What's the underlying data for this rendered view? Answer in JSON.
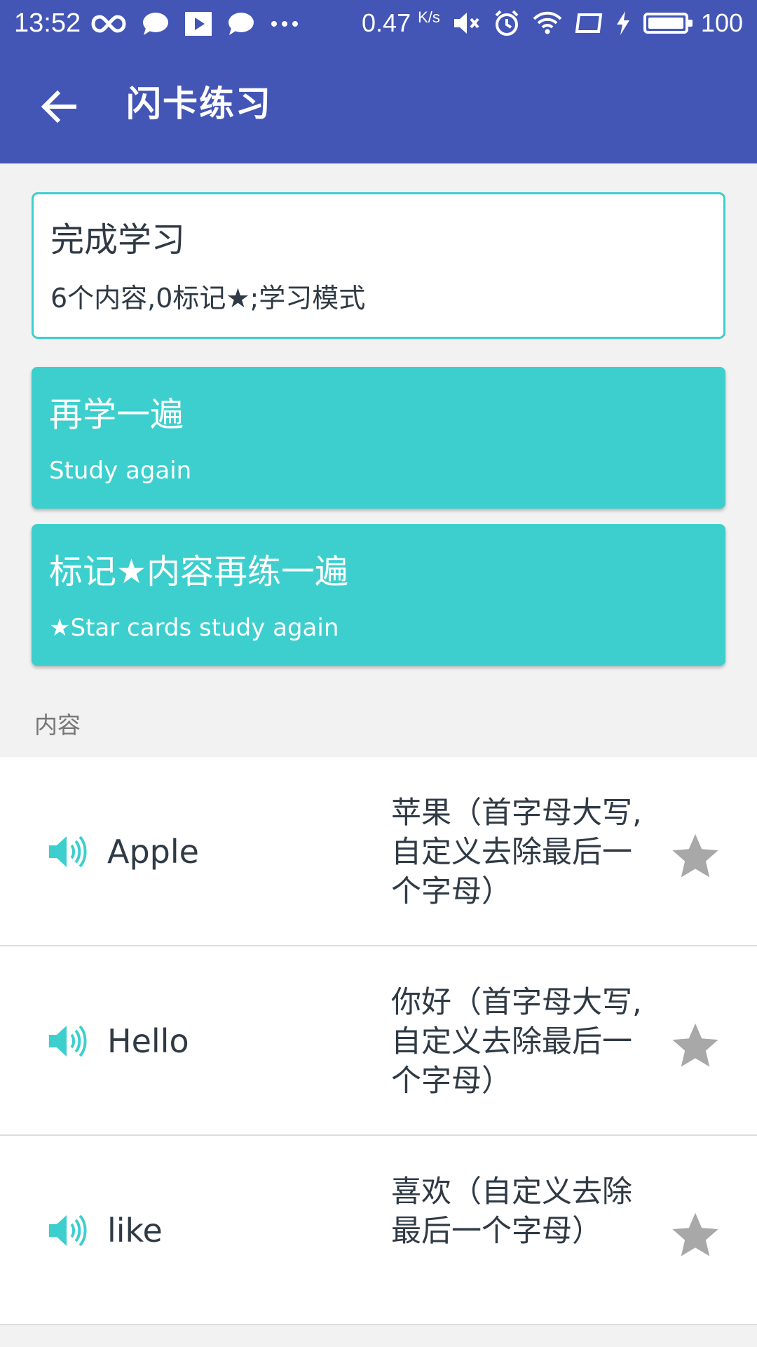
{
  "status_bar": {
    "time": "13:52",
    "speed_value": "0.47",
    "speed_unit": "K/s",
    "battery": "100",
    "left_icons": [
      "infinity-icon",
      "chat-bubble-icon",
      "play-icon",
      "chat-bubble-icon",
      "more-dots-icon"
    ],
    "right_icons": [
      "mute-icon",
      "alarm-icon",
      "wifi-icon",
      "screen-icon",
      "charging-icon",
      "battery-icon"
    ]
  },
  "toolbar": {
    "title": "闪卡练习",
    "back_icon": "arrow-left-icon",
    "background_color": "#4355b5"
  },
  "summary": {
    "title": "完成学习",
    "subtitle": "6个内容,0标记★;学习模式"
  },
  "actions": [
    {
      "title": "再学一遍",
      "subtitle": "Study again"
    },
    {
      "title": "标记★内容再练一遍",
      "subtitle": "★Star cards study again"
    }
  ],
  "accent_color": "#3ccfce",
  "section_label": "内容",
  "items": [
    {
      "word": "Apple",
      "meaning": "苹果（首字母大写,自定义去除最后一个字母）",
      "starred": false
    },
    {
      "word": "Hello",
      "meaning": "你好（首字母大写,自定义去除最后一个字母）",
      "starred": false
    },
    {
      "word": "like",
      "meaning": "喜欢（自定义去除最后一个字母）",
      "starred": false
    }
  ]
}
